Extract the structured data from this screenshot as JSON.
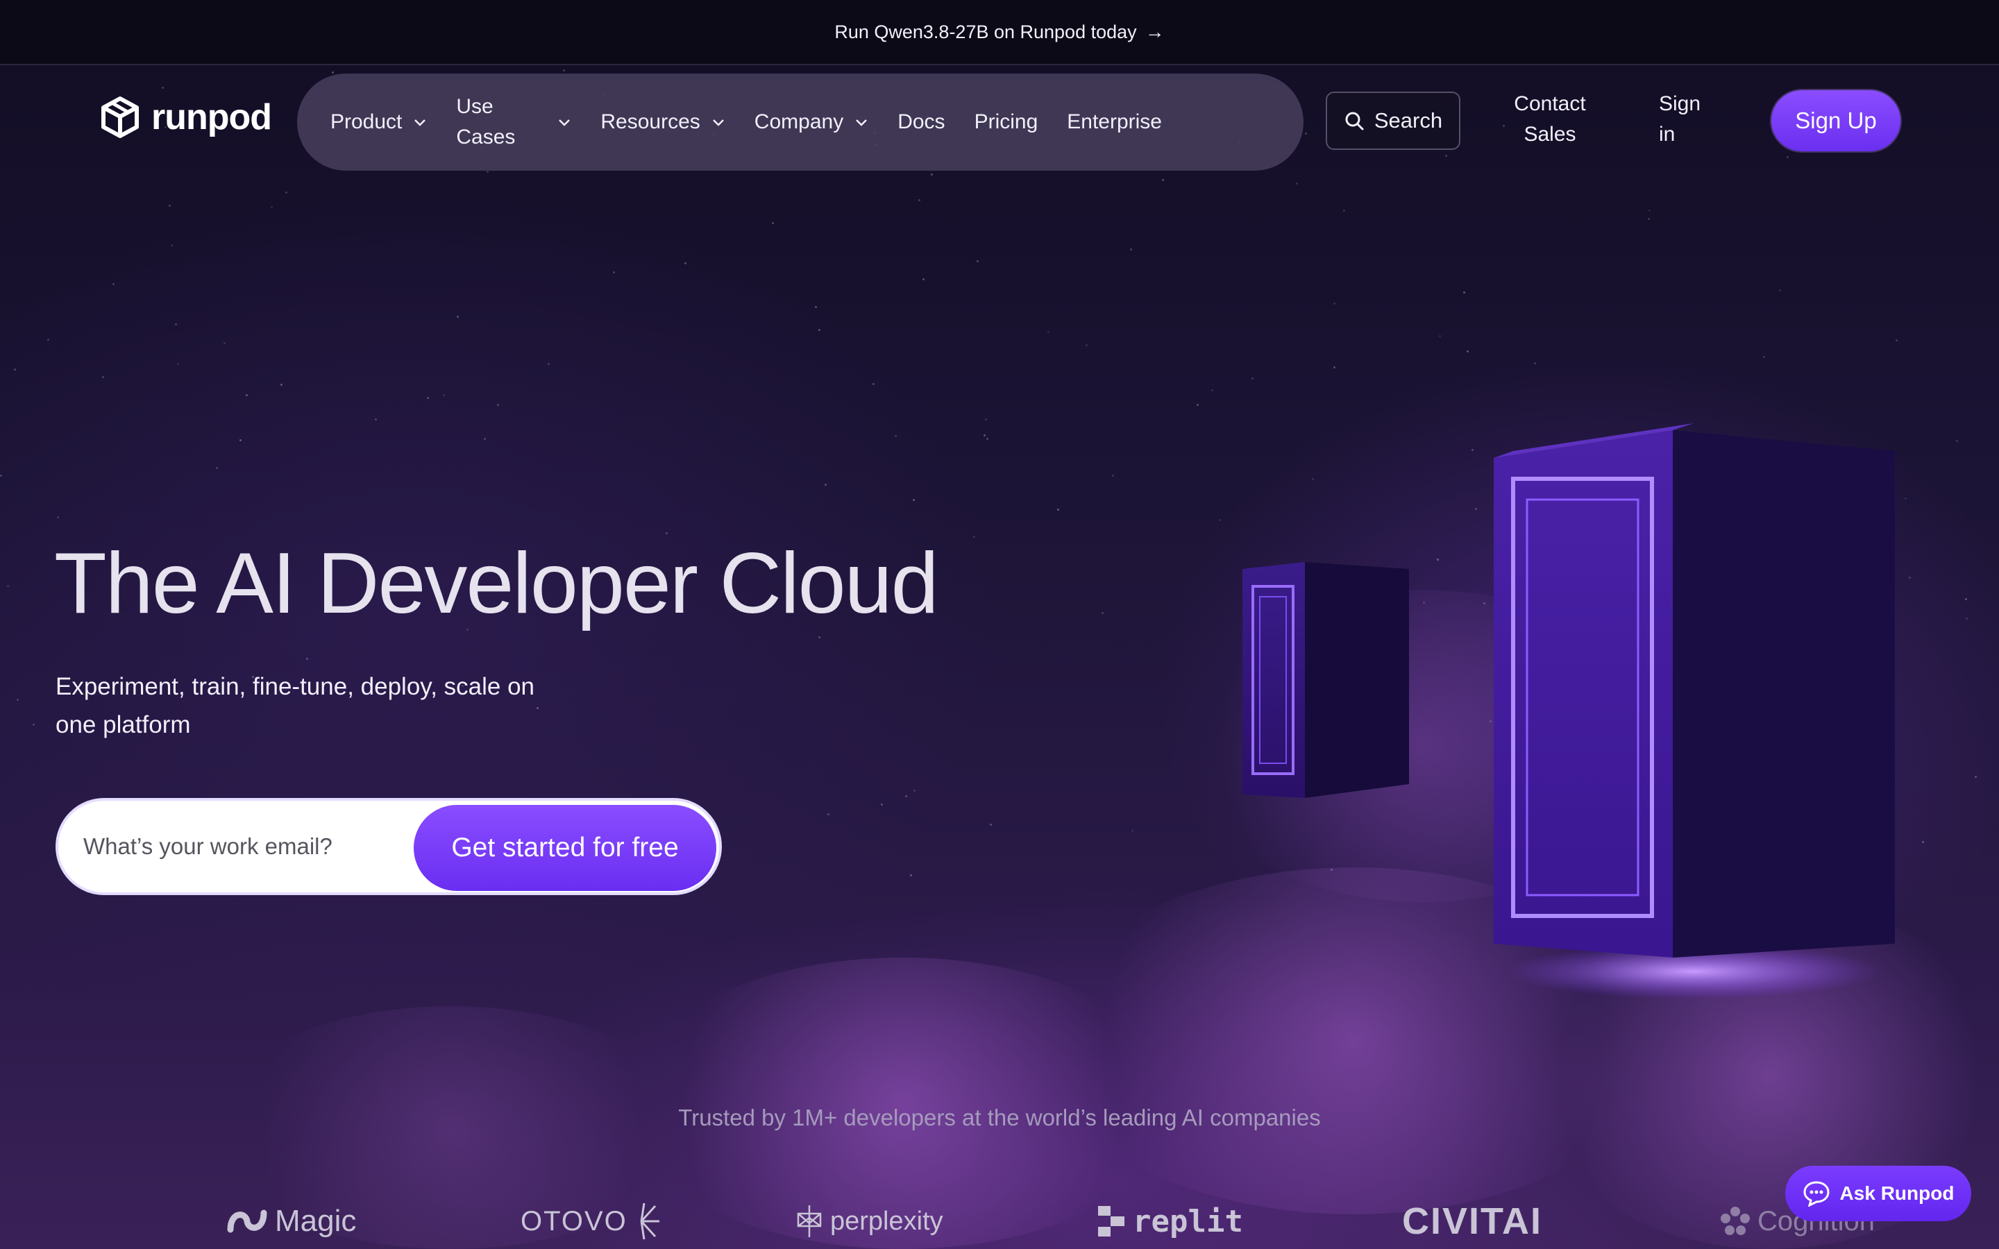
{
  "announcement": {
    "text": "Run Qwen3.8-27B on Runpod today",
    "arrow": "→"
  },
  "header": {
    "logo_text": "runpod",
    "nav": [
      {
        "label": "Product",
        "has_dropdown": true
      },
      {
        "label": "Use Cases",
        "has_dropdown": true
      },
      {
        "label": "Resources",
        "has_dropdown": true
      },
      {
        "label": "Company",
        "has_dropdown": true
      },
      {
        "label": "Docs",
        "has_dropdown": false
      },
      {
        "label": "Pricing",
        "has_dropdown": false
      },
      {
        "label": "Enterprise",
        "has_dropdown": false
      }
    ],
    "search_label": "Search",
    "contact_sales_label": "Contact Sales",
    "sign_in_label": "Sign in",
    "sign_up_label": "Sign Up"
  },
  "hero": {
    "title": "The AI Developer Cloud",
    "subtitle": "Experiment, train, fine-tune, deploy, scale on one platform",
    "email_placeholder": "What’s your work email?",
    "cta_label": "Get started for free"
  },
  "trusted": {
    "text": "Trusted by 1M+ developers at the world’s leading AI companies",
    "logos": [
      "Magic",
      "OTOVO",
      "perplexity",
      "replit",
      "CIVITAI",
      "Cognition"
    ]
  },
  "chat_widget": {
    "label": "Ask Runpod"
  },
  "colors": {
    "accent": "#7b3cff",
    "background": "#15102a",
    "nav_pill": "#463e5c"
  }
}
